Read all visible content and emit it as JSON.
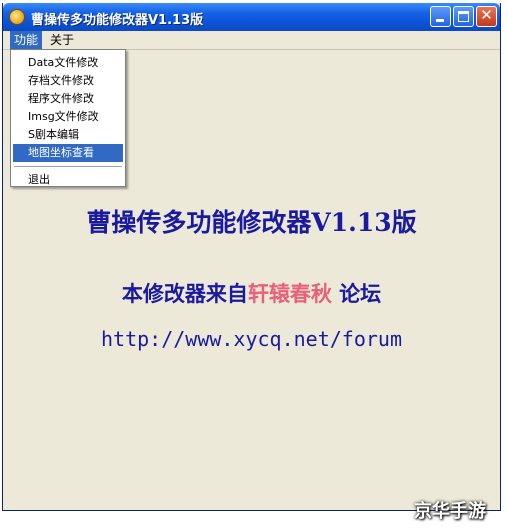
{
  "window": {
    "title": "曹操传多功能修改器V1.13版"
  },
  "menubar": {
    "function": "功能",
    "about": "关于"
  },
  "dropdown": {
    "items": [
      "Data文件修改",
      "存档文件修改",
      "程序文件修改",
      "Imsg文件修改",
      "S剧本编辑",
      "地图坐标查看",
      "退出"
    ],
    "selected_index": 5
  },
  "content": {
    "title": "曹操传多功能修改器V1.13版",
    "subtitle_pre": "本修改器来自",
    "subtitle_highlight": "轩辕春秋",
    "subtitle_post": "论坛",
    "url": "http://www.xycq.net/forum"
  },
  "watermark": "京华手游",
  "colors": {
    "titlebar": "#0c53d6",
    "menu_highlight": "#316ac5",
    "text_blue": "#1a1aa0",
    "text_pink": "#e8607a",
    "background": "#ece9d8"
  }
}
